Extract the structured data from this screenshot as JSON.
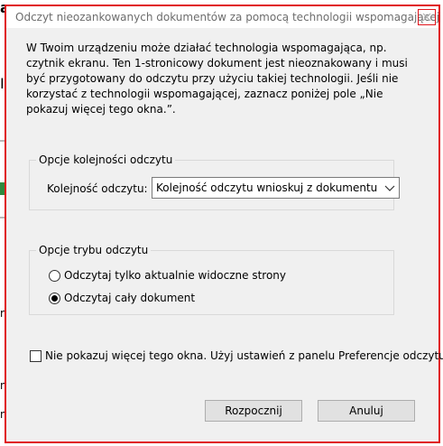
{
  "background_fragments": [
    "a",
    "I",
    "r",
    "n",
    "n"
  ],
  "dialog": {
    "title": "Odczyt nieozankowanych dokumentów za pomocą technologii wspomagającej",
    "intro": "W Twoim urządzeniu może działać technologia wspomagająca, np. czytnik ekranu. Ten 1-stronicowy dokument jest nieoznakowany i musi być przygotowany do odczytu przy użyciu takiej technologii. Jeśli nie korzystać z technologii wspomagającej, zaznacz poniżej pole „Nie pokazuj więcej tego okna.”.",
    "reading_order": {
      "legend": "Opcje kolejności odczytu",
      "label": "Kolejność odczytu:",
      "selected": "Kolejność odczytu wnioskuj z dokumentu (zalecane)"
    },
    "reading_mode": {
      "legend": "Opcje trybu odczytu",
      "options": [
        {
          "label": "Odczytaj tylko aktualnie widoczne strony",
          "checked": false
        },
        {
          "label": "Odczytaj cały dokument",
          "checked": true
        }
      ]
    },
    "dont_show": {
      "label": "Nie pokazuj więcej tego okna. Użyj ustawień z panelu Preferencje odczytu.",
      "checked": false
    },
    "buttons": {
      "start": "Rozpocznij",
      "cancel": "Anuluj"
    }
  },
  "colors": {
    "highlight_border": "#e0141b",
    "dialog_bg": "#f0f0f0"
  }
}
